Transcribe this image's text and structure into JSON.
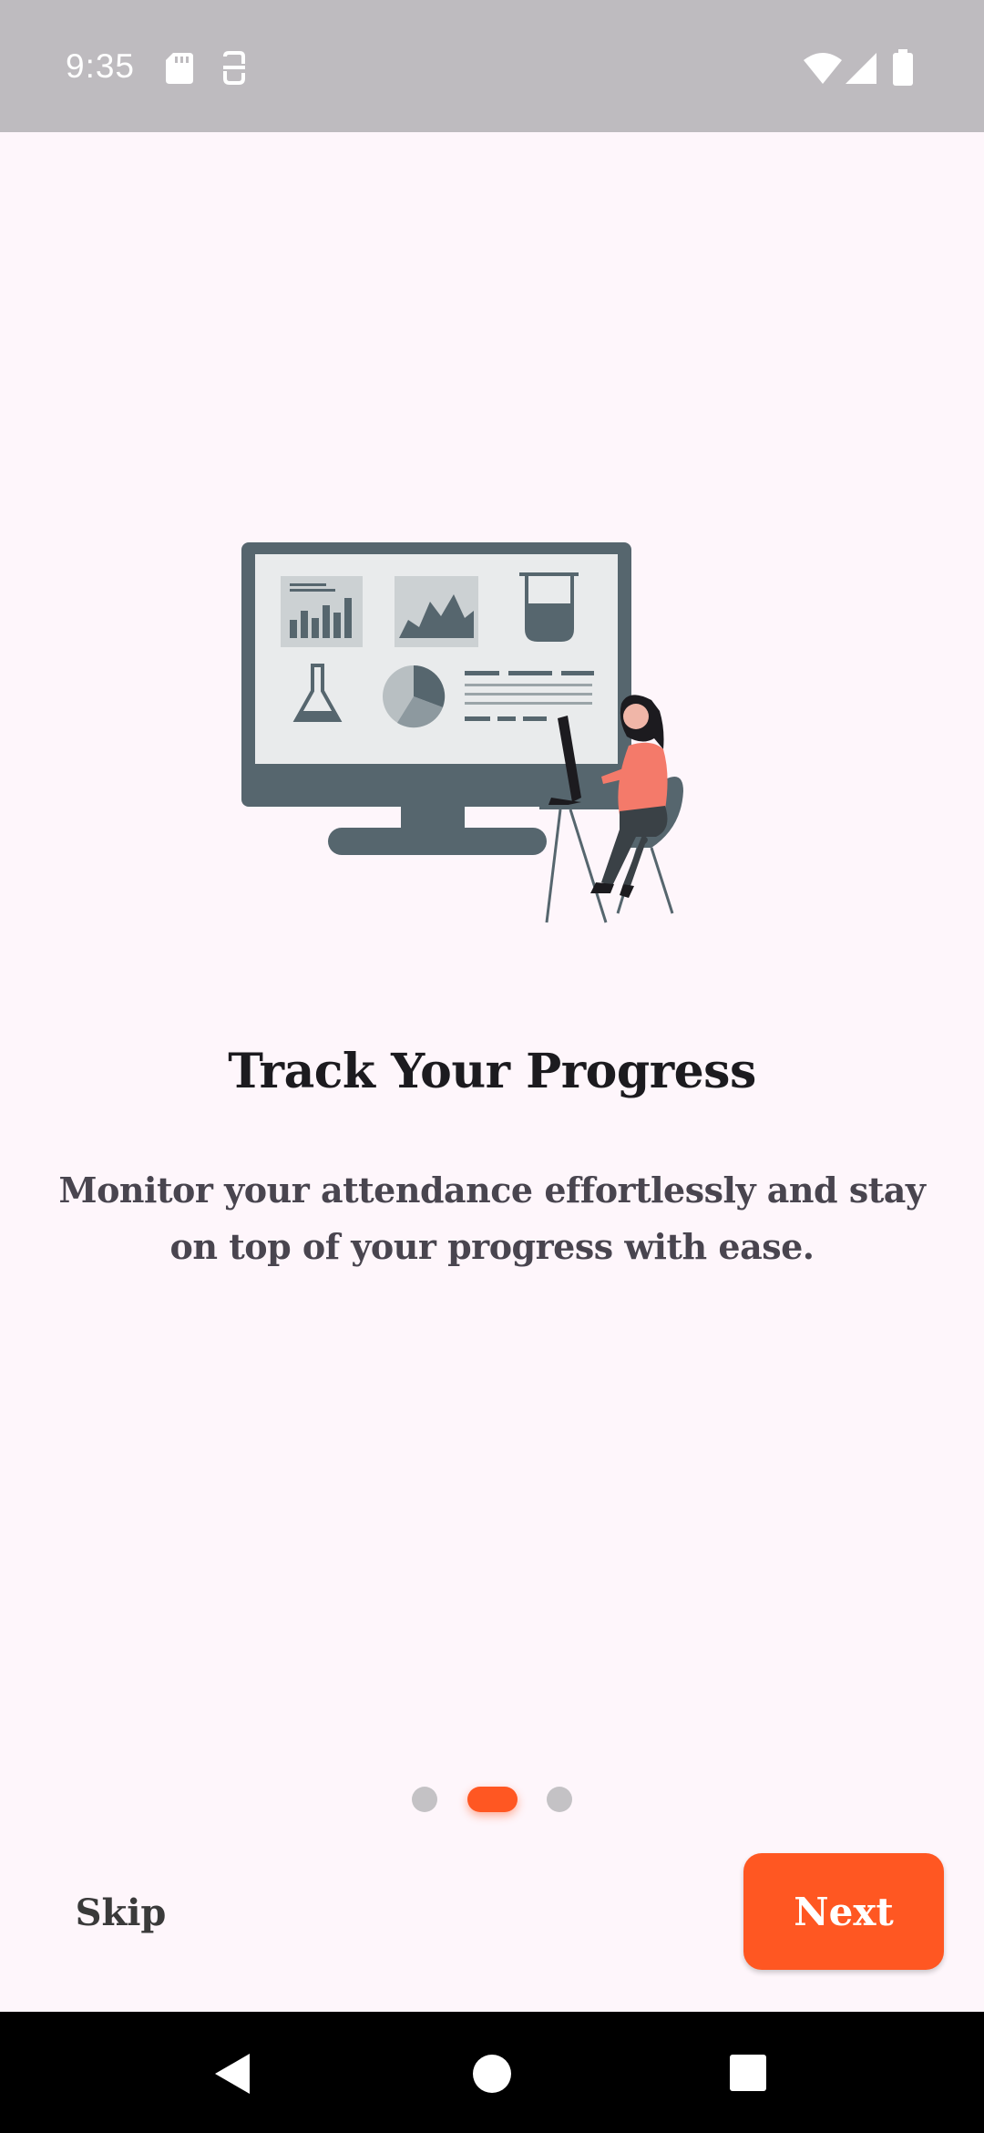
{
  "status_bar": {
    "time": "9:35",
    "left_icons": [
      "sd-card-icon",
      "accessibility-icon"
    ],
    "right_icons": [
      "wifi-icon",
      "signal-icon",
      "battery-icon"
    ]
  },
  "onboarding": {
    "illustration": "person-at-desk-with-analytics-monitor",
    "title": "Track Your Progress",
    "description": "Monitor your attendance effortlessly and stay on top of your progress with ease.",
    "page_indicator": {
      "total": 3,
      "active_index": 1
    },
    "skip_label": "Skip",
    "next_label": "Next"
  },
  "colors": {
    "accent": "#ff5722",
    "background": "#fef6fb",
    "status_bar": "#bebbbf",
    "inactive_dot": "#c4c2c5"
  },
  "nav_bar": {
    "icons": [
      "back-icon",
      "home-icon",
      "recents-icon"
    ]
  }
}
